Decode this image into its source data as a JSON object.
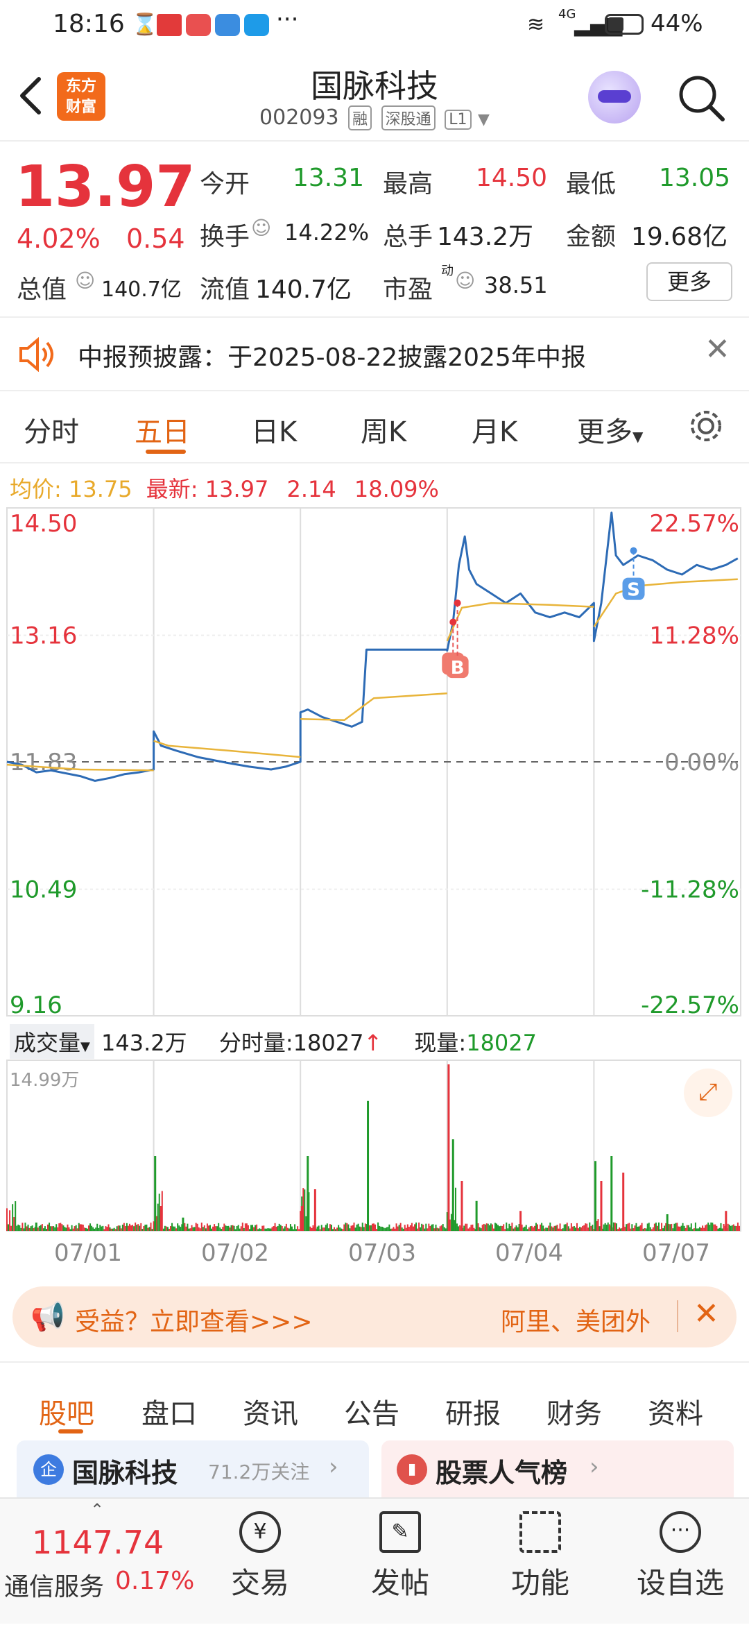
{
  "status_bar": {
    "time": "18:16",
    "network": "4G",
    "battery": "44%"
  },
  "header": {
    "logo_line1": "东方",
    "logo_line2": "财富",
    "title": "国脉科技",
    "code": "002093",
    "tags": [
      "融",
      "深股通",
      "L1"
    ]
  },
  "quote": {
    "price": "13.97",
    "change_pct": "4.02%",
    "change": "0.54",
    "open_label": "今开",
    "open": "13.31",
    "high_label": "最高",
    "high": "14.50",
    "low_label": "最低",
    "low": "13.05",
    "turnover_label": "换手",
    "turnover": "14.22%",
    "volume_label": "总手",
    "volume": "143.2万",
    "amount_label": "金额",
    "amount": "19.68亿",
    "mktcap_label": "总值",
    "mktcap": "140.7亿",
    "float_label": "流值",
    "float": "140.7亿",
    "pe_label": "市盈",
    "pe_sup": "动",
    "pe": "38.51",
    "more_button": "更多"
  },
  "notice": {
    "text": "中报预披露：于2025-08-22披露2025年中报"
  },
  "chart_tabs": [
    "分时",
    "五日",
    "日K",
    "周K",
    "月K",
    "更多"
  ],
  "chart_tabs_active": "五日",
  "chart_info": {
    "avg_label": "均价:",
    "avg": "13.75",
    "latest_label": "最新:",
    "latest": "13.97",
    "chg": "2.14",
    "chg_pct": "18.09%"
  },
  "chart_data": {
    "type": "line",
    "title": "",
    "dates": [
      "07/01",
      "07/02",
      "07/03",
      "07/04",
      "07/07"
    ],
    "ylim": [
      9.16,
      14.5
    ],
    "y_ticks_left": [
      "14.50",
      "13.16",
      "11.83",
      "10.49",
      "9.16"
    ],
    "y_ticks_right": [
      "22.57%",
      "11.28%",
      "0.00%",
      "-11.28%",
      "-22.57%"
    ],
    "reference_price": 11.83,
    "series": [
      {
        "name": "price",
        "color": "#2d6bb5",
        "points": [
          [
            0,
            11.83
          ],
          [
            0.1,
            11.8
          ],
          [
            0.2,
            11.72
          ],
          [
            0.3,
            11.74
          ],
          [
            0.5,
            11.68
          ],
          [
            0.6,
            11.63
          ],
          [
            0.7,
            11.66
          ],
          [
            0.8,
            11.7
          ],
          [
            0.9,
            11.72
          ],
          [
            1.0,
            11.75
          ],
          [
            1.0,
            12.15
          ],
          [
            1.05,
            12.0
          ],
          [
            1.15,
            11.95
          ],
          [
            1.3,
            11.88
          ],
          [
            1.5,
            11.82
          ],
          [
            1.65,
            11.78
          ],
          [
            1.8,
            11.75
          ],
          [
            1.9,
            11.78
          ],
          [
            2.0,
            11.83
          ],
          [
            2.0,
            12.35
          ],
          [
            2.05,
            12.38
          ],
          [
            2.15,
            12.3
          ],
          [
            2.25,
            12.25
          ],
          [
            2.35,
            12.2
          ],
          [
            2.42,
            12.25
          ],
          [
            2.45,
            13.01
          ],
          [
            2.6,
            13.01
          ],
          [
            2.9,
            13.01
          ],
          [
            3.0,
            13.01
          ],
          [
            3.0,
            13.0
          ],
          [
            3.04,
            13.3
          ],
          [
            3.08,
            13.9
          ],
          [
            3.12,
            14.2
          ],
          [
            3.15,
            13.85
          ],
          [
            3.2,
            13.7
          ],
          [
            3.3,
            13.6
          ],
          [
            3.4,
            13.5
          ],
          [
            3.5,
            13.6
          ],
          [
            3.6,
            13.4
          ],
          [
            3.7,
            13.35
          ],
          [
            3.8,
            13.4
          ],
          [
            3.9,
            13.35
          ],
          [
            4.0,
            13.5
          ],
          [
            4.0,
            13.1
          ],
          [
            4.05,
            13.5
          ],
          [
            4.12,
            14.45
          ],
          [
            4.15,
            14.0
          ],
          [
            4.2,
            13.9
          ],
          [
            4.3,
            14.0
          ],
          [
            4.4,
            13.95
          ],
          [
            4.5,
            13.85
          ],
          [
            4.6,
            13.8
          ],
          [
            4.7,
            13.9
          ],
          [
            4.8,
            13.85
          ],
          [
            4.9,
            13.9
          ],
          [
            4.98,
            13.97
          ]
        ]
      },
      {
        "name": "avg",
        "color": "#e8b43a",
        "points": [
          [
            0,
            11.8
          ],
          [
            0.5,
            11.75
          ],
          [
            1.0,
            11.74
          ],
          [
            1.0,
            12.05
          ],
          [
            1.1,
            12.0
          ],
          [
            1.5,
            11.95
          ],
          [
            2.0,
            11.88
          ],
          [
            2.0,
            12.28
          ],
          [
            2.3,
            12.27
          ],
          [
            2.5,
            12.5
          ],
          [
            3.0,
            12.55
          ],
          [
            3.0,
            13.1
          ],
          [
            3.1,
            13.45
          ],
          [
            3.3,
            13.5
          ],
          [
            3.7,
            13.48
          ],
          [
            4.0,
            13.46
          ],
          [
            4.0,
            13.25
          ],
          [
            4.15,
            13.6
          ],
          [
            4.3,
            13.68
          ],
          [
            4.6,
            13.72
          ],
          [
            4.98,
            13.75
          ]
        ]
      }
    ],
    "markers": [
      {
        "label": "B",
        "x": 3.04,
        "y": 13.3
      },
      {
        "label": "B",
        "x": 3.07,
        "y": 13.5
      },
      {
        "label": "S",
        "x": 4.27,
        "y": 14.05
      }
    ],
    "volume": {
      "label": "成交量",
      "total": "143.2万",
      "minute_label": "分时量:",
      "minute": "18027",
      "current_label": "现量:",
      "current": "18027",
      "ymax_label": "14.99万",
      "spikes": [
        [
          0.2,
          0.05
        ],
        [
          0.5,
          0.04
        ],
        [
          1.01,
          0.45
        ],
        [
          1.05,
          0.15
        ],
        [
          1.2,
          0.08
        ],
        [
          2.01,
          0.15
        ],
        [
          2.05,
          0.45
        ],
        [
          2.1,
          0.25
        ],
        [
          2.46,
          0.78
        ],
        [
          3.01,
          1.0
        ],
        [
          3.04,
          0.55
        ],
        [
          3.1,
          0.3
        ],
        [
          3.2,
          0.18
        ],
        [
          3.5,
          0.12
        ],
        [
          4.01,
          0.42
        ],
        [
          4.05,
          0.3
        ],
        [
          4.12,
          0.45
        ],
        [
          4.2,
          0.35
        ],
        [
          4.5,
          0.1
        ],
        [
          4.9,
          0.12
        ]
      ]
    }
  },
  "banner": {
    "left_text": "受益？立即查看>>>",
    "right_text": "阿里、美团外"
  },
  "bottom_tabs": [
    "股吧",
    "盘口",
    "资讯",
    "公告",
    "研报",
    "财务",
    "资料"
  ],
  "bottom_tabs_active": "股吧",
  "cards": {
    "left_title": "国脉科技",
    "left_follow": "71.2万关注",
    "right_title": "股票人气榜"
  },
  "bottom_nav": {
    "index_value": "1147.74",
    "index_name": "通信服务",
    "index_pct": "0.17%",
    "items": [
      "交易",
      "发帖",
      "功能",
      "设自选"
    ]
  }
}
